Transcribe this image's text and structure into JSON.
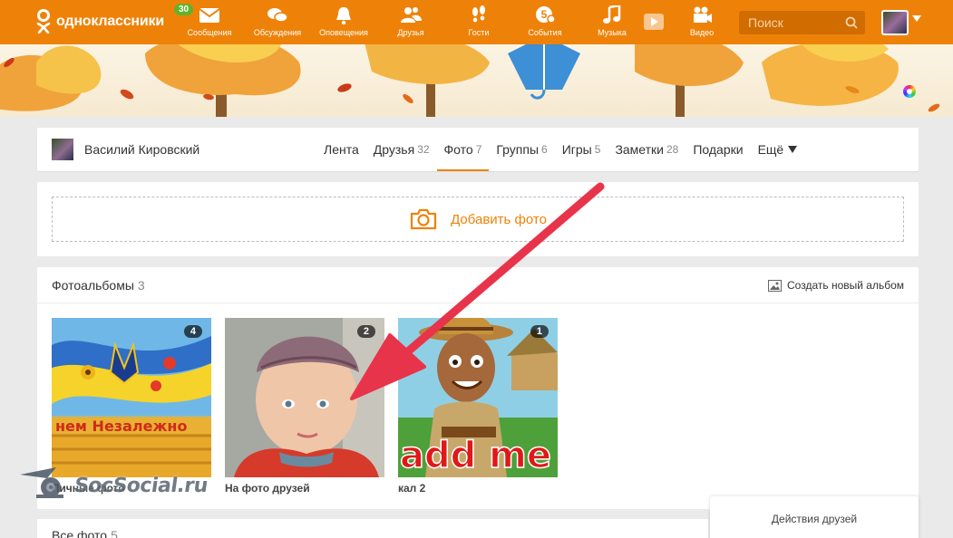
{
  "brand": {
    "name": "одноклассники",
    "badge": "30"
  },
  "nav": [
    {
      "label": "Сообщения",
      "icon": "envelope-icon"
    },
    {
      "label": "Обсуждения",
      "icon": "chat-bubbles-icon"
    },
    {
      "label": "Оповещения",
      "icon": "bell-icon"
    },
    {
      "label": "Друзья",
      "icon": "friends-icon"
    },
    {
      "label": "Гости",
      "icon": "footprints-icon"
    },
    {
      "label": "События",
      "icon": "events-icon",
      "badge": "5"
    },
    {
      "label": "Музыка",
      "icon": "music-note-icon"
    },
    {
      "label": "Видео",
      "icon": "video-camera-icon"
    }
  ],
  "search": {
    "placeholder": "Поиск"
  },
  "profile": {
    "name": "Василий Кировский",
    "tabs": [
      {
        "label": "Лента",
        "count": ""
      },
      {
        "label": "Друзья",
        "count": "32"
      },
      {
        "label": "Фото",
        "count": "7",
        "active": true
      },
      {
        "label": "Группы",
        "count": "6"
      },
      {
        "label": "Игры",
        "count": "5"
      },
      {
        "label": "Заметки",
        "count": "28"
      },
      {
        "label": "Подарки",
        "count": ""
      },
      {
        "label": "Ещё",
        "count": ""
      }
    ]
  },
  "add_photo": {
    "label": "Добавить фото"
  },
  "albums": {
    "title": "Фотоальбомы",
    "count": "3",
    "create_label": "Создать новый альбом",
    "items": [
      {
        "name": "Личные фото",
        "count": "4",
        "thumb_text": "нем Незалежно"
      },
      {
        "name": "На фото друзей",
        "count": "2"
      },
      {
        "name": "кал 2",
        "count": "1",
        "thumb_text": "add me"
      }
    ]
  },
  "all_photos": {
    "title": "Все фото",
    "count": "5"
  },
  "friends_actions": {
    "label": "Действия друзей"
  },
  "watermark": {
    "text": "SocSocial.ru"
  },
  "colors": {
    "brand": "#ee8208",
    "badge": "#62b22a",
    "arrow": "#e8344a"
  }
}
